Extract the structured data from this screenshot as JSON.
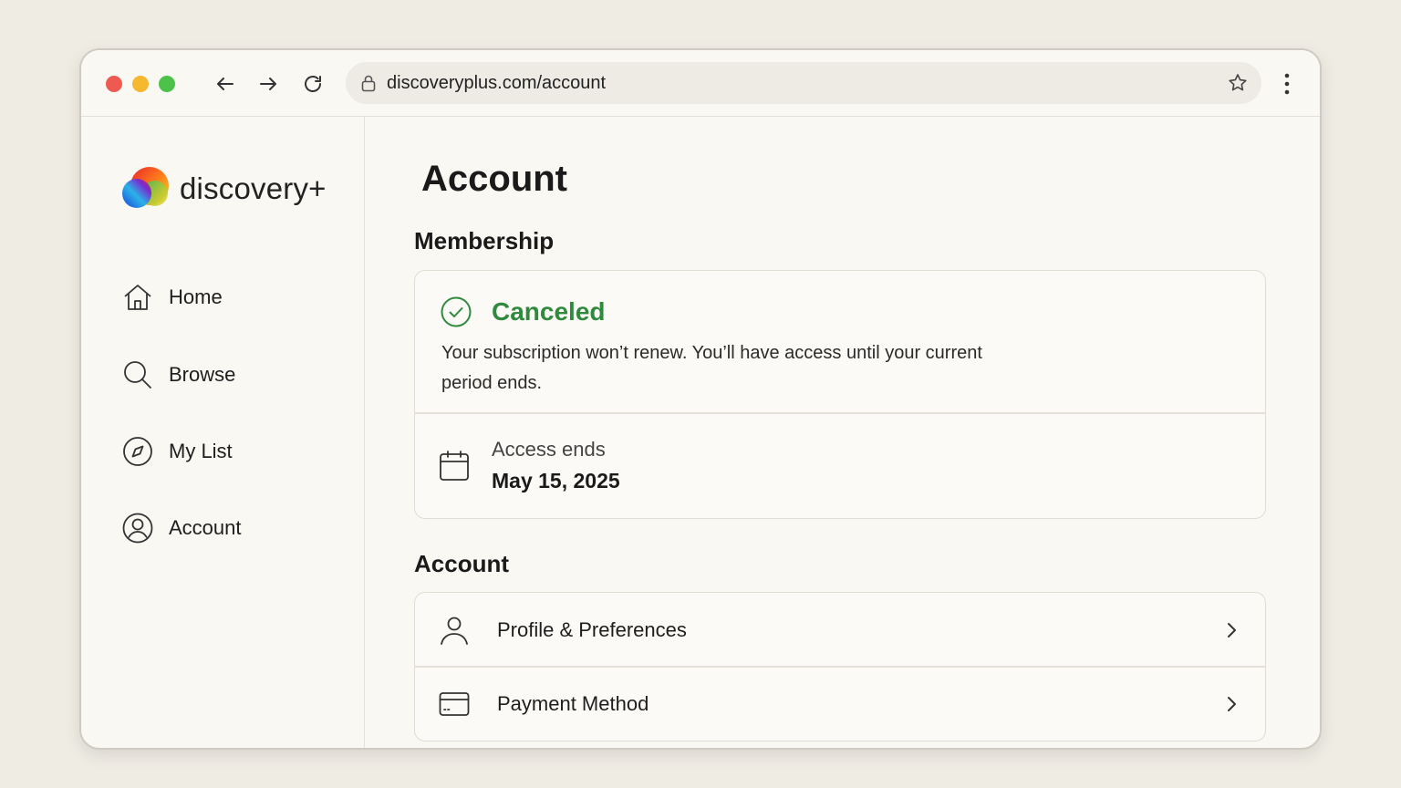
{
  "browser": {
    "url": "discoveryplus.com/account",
    "icons": [
      "back-icon",
      "forward-icon",
      "reload-icon",
      "lock-icon",
      "star-icon",
      "more-vertical-icon"
    ]
  },
  "sidebar": {
    "brand": "discovery+",
    "items": [
      {
        "label": "Home",
        "icon": "home-icon"
      },
      {
        "label": "Browse",
        "icon": "search-icon"
      },
      {
        "label": "My List",
        "icon": "compass-icon"
      },
      {
        "label": "Account",
        "icon": "user-circle-icon"
      }
    ]
  },
  "main": {
    "title": "Account",
    "membership": {
      "heading": "Membership",
      "status": "Canceled",
      "status_color": "#2f8a3e",
      "description": "Your subscription won’t renew. You’ll have access until your current period ends.",
      "access_label": "Access ends",
      "access_date": "May 15, 2025"
    },
    "account": {
      "heading": "Account",
      "rows": [
        {
          "label": "Profile & Preferences",
          "icon": "person-icon"
        },
        {
          "label": "Payment Method",
          "icon": "credit-card-icon"
        }
      ]
    }
  }
}
